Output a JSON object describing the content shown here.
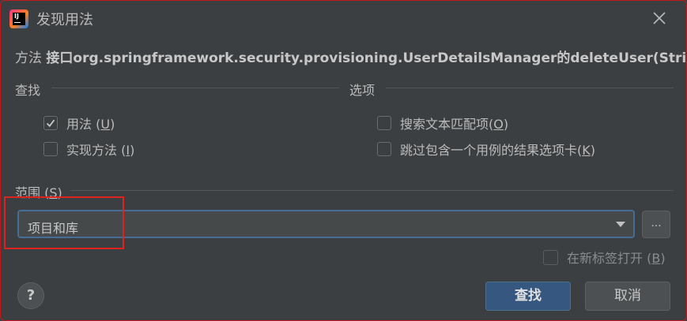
{
  "window": {
    "title": "发现用法",
    "app_icon_text": "IJ"
  },
  "method": {
    "prefix": "方法",
    "signature": "接口org.springframework.security.provisioning.UserDetailsManager的deleteUser(String)"
  },
  "find_section": {
    "label": "查找",
    "options": [
      {
        "label": "用法 (",
        "mnemonic": "U",
        "suffix": ")",
        "checked": true
      },
      {
        "label": "实现方法 (",
        "mnemonic": "I",
        "suffix": ")",
        "checked": false
      }
    ]
  },
  "options_section": {
    "label": "选项",
    "options": [
      {
        "label": "搜索文本匹配项(",
        "mnemonic": "O",
        "suffix": ")",
        "checked": false
      },
      {
        "label": "跳过包含一个用例的结果选项卡(",
        "mnemonic": "K",
        "suffix": ")",
        "checked": false
      }
    ]
  },
  "scope_section": {
    "label": "范围 (",
    "mnemonic": "S",
    "suffix": ")",
    "selected": "项目和库",
    "browse_label": "...",
    "new_tab": {
      "label": "在新标签打开 (",
      "mnemonic": "B",
      "suffix": ")",
      "checked": false
    }
  },
  "footer": {
    "help_label": "?",
    "find_label": "查找",
    "cancel_label": "取消"
  },
  "colors": {
    "background": "#3c3f41",
    "accent": "#365880",
    "focus_border": "#466d94",
    "annotation": "#e0221f"
  }
}
